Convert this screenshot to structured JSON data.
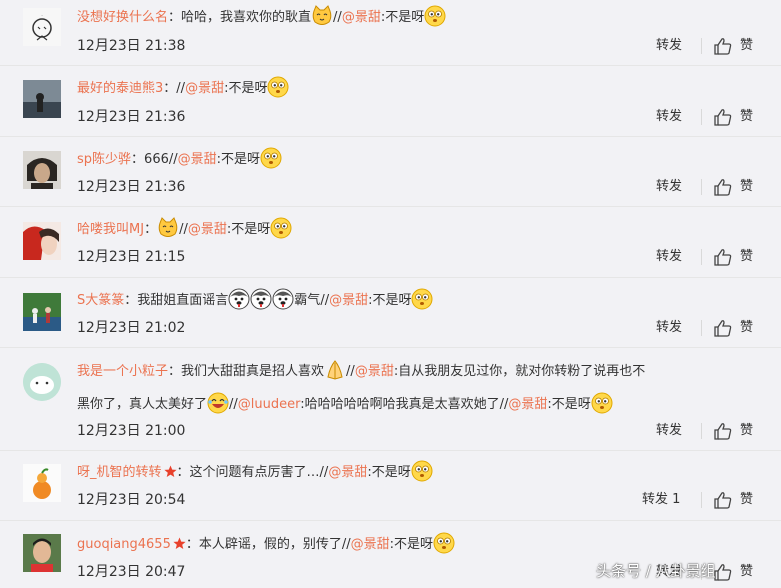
{
  "colors": {
    "accent": "#eb7350",
    "text": "#333333",
    "background": "#f2f2f5"
  },
  "comments": [
    {
      "username": "没想好换什么名",
      "sep": "：",
      "text1": "哈哈，我喜欢你的耿直",
      "text2": "//",
      "mention": "@景甜",
      "text3": ":不是呀",
      "time": "12月23日 21:38",
      "repost": "转发",
      "like": "赞"
    },
    {
      "username": "最好的泰迪熊3",
      "sep": "：",
      "text2": "//",
      "mention": "@景甜",
      "text3": ":不是呀",
      "time": "12月23日 21:36",
      "repost": "转发",
      "like": "赞"
    },
    {
      "username": "sp陈少骅",
      "sep": "：",
      "text1": "666",
      "text2": "//",
      "mention": "@景甜",
      "text3": ":不是呀",
      "time": "12月23日 21:36",
      "repost": "转发",
      "like": "赞"
    },
    {
      "username": "哈喽我叫MJ",
      "sep": "：",
      "text2": "//",
      "mention": "@景甜",
      "text3": ":不是呀",
      "time": "12月23日 21:15",
      "repost": "转发",
      "like": "赞"
    },
    {
      "username": "S大篆篆",
      "sep": "：",
      "text1": "我甜姐直面谣言",
      "text1b": "霸气",
      "text2": "//",
      "mention": "@景甜",
      "text3": ":不是呀",
      "time": "12月23日 21:02",
      "repost": "转发",
      "like": "赞"
    },
    {
      "username": "我是一个小粒子",
      "sep": "：",
      "text1": "我们大甜甜真是招人喜欢",
      "text2": "//",
      "mention": "@景甜",
      "text3": ":自从我朋友见过你，就对你转粉了说再也不",
      "line2a": "黑你了，真人太美好了",
      "line2b": "//",
      "mention2": "@luudeer",
      "line2c": ":哈哈哈哈哈啊哈我真是太喜欢她了",
      "line2d": "//",
      "mention3": "@景甜",
      "line2e": ":不是呀",
      "time": "12月23日 21:00",
      "repost": "转发",
      "like": "赞"
    },
    {
      "username": "呀_机智的转转",
      "sep": "：",
      "text1": "这个问题有点厉害了…",
      "text2": "//",
      "mention": "@景甜",
      "text3": ":不是呀",
      "time": "12月23日 20:54",
      "repost": "转发 1",
      "like": "赞"
    },
    {
      "username": "guoqiang4655",
      "sep": "：",
      "text1": "本人辟谣，假的，别传了",
      "text2": "//",
      "mention": "@景甜",
      "text3": ":不是呀",
      "time": "12月23日 20:47",
      "repost": "转发",
      "like": "赞"
    }
  ],
  "watermark": "头条号 / 八卦景组"
}
